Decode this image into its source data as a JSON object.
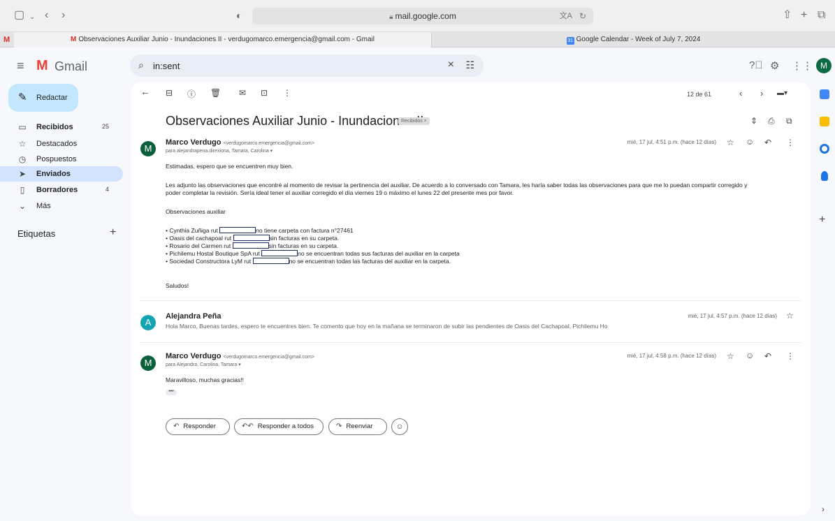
{
  "browser": {
    "address": "mail.google.com",
    "tabs": [
      {
        "label": "Observaciones Auxiliar Junio - Inundaciones II - verdugomarco.emergencia@gmail.com - Gmail",
        "favicon": "gmail-icon"
      },
      {
        "label": "Google Calendar - Week of July 7, 2024",
        "favicon": "calendar-icon",
        "favicon_text": "31"
      }
    ],
    "pinned_tab": "M"
  },
  "gmail": {
    "app_name": "Gmail",
    "search_value": "in:sent",
    "avatar_letter": "M"
  },
  "sidebar": {
    "compose_label": "Redactar",
    "items": [
      {
        "label": "Recibidos",
        "count": "25",
        "icon": "inbox-icon"
      },
      {
        "label": "Destacados",
        "count": "",
        "icon": "star-icon"
      },
      {
        "label": "Pospuestos",
        "count": "",
        "icon": "clock-icon"
      },
      {
        "label": "Enviados",
        "count": "",
        "icon": "send-icon"
      },
      {
        "label": "Borradores",
        "count": "4",
        "icon": "draft-icon"
      },
      {
        "label": "Más",
        "count": "",
        "icon": "chevron-down-icon"
      }
    ],
    "labels_title": "Etiquetas"
  },
  "toolbar": {
    "pager": "12 de 61"
  },
  "thread": {
    "subject": "Observaciones Auxiliar Junio - Inundaciones II",
    "label_chip": "Recibidos ×",
    "messages": [
      {
        "avatar": "M",
        "sender": "Marco Verdugo",
        "email": "<verdugomarco.emergencia@gmail.com>",
        "to": "para alejandrapena.direxiona, Tamara, Carolina ▾",
        "date": "mié, 17 jul, 4:51 p.m. (hace 12 días)",
        "greeting": "Estimadas, espero que se encuentren muy bien.",
        "paragraph_line1": "Les adjunto las observaciones que encontré al momento de revisar la pertinencia del auxiliar. De acuerdo a lo conversado con Tamara, les haría saber todas las observaciones para que me lo puedan compartir corregido y",
        "paragraph_line2": "poder completar la revisión. Sería ideal tener el auxiliar corregido el día viernes 19 o máximo el lunes 22 del presente mes por favor.",
        "obs_title": "Observaciones auxiliar",
        "bullets": [
          {
            "before": "• Cynthia Zuñiga rut ",
            "after": "no tiene carpeta con factura n°27461"
          },
          {
            "before": "• Oasis del cachapoal rut ",
            "after": "sin facturas en su carpeta."
          },
          {
            "before": "• Rosario del Carmen rut ",
            "after": "sin facturas en su carpeta."
          },
          {
            "before": "• Pichilemu Hostal Boutique SpA rut ",
            "after": "no se encuentran todas sus facturas del auxiliar en la carpeta"
          },
          {
            "before": "• Sociedad Constructora LyM rut ",
            "after": "no se encuentran todas las facturas del auxiliar en la carpeta."
          }
        ],
        "closing": "Saludos!"
      },
      {
        "avatar": "A",
        "sender": "Alejandra Peña",
        "date": "mié, 17 jul, 4:57 p.m. (hace 12 días)",
        "snippet": "Hola Marco, Buenas tardes, espero te encuentres bien. Te comento que hoy en la mañana se terminaron de subir las pendientes de Oasis del Cachapoal, Pichilemu Ho"
      },
      {
        "avatar": "M",
        "sender": "Marco Verdugo",
        "email": "<verdugomarco.emergencia@gmail.com>",
        "to": "para Alejandra, Carolina, Tamara ▾",
        "date": "mié, 17 jul, 4:58 p.m. (hace 12 días)",
        "body": "Maravilloso, muchas gracias!!",
        "dots": "•••"
      }
    ],
    "actions": {
      "reply": "Responder",
      "reply_all": "Responder a todos",
      "forward": "Reenviar"
    }
  },
  "colors": {
    "accent": "#c2e7ff",
    "active_nav": "#d3e3fd",
    "avatar_marco": "#0b5f3a",
    "avatar_alejandra": "#12a4b0"
  }
}
